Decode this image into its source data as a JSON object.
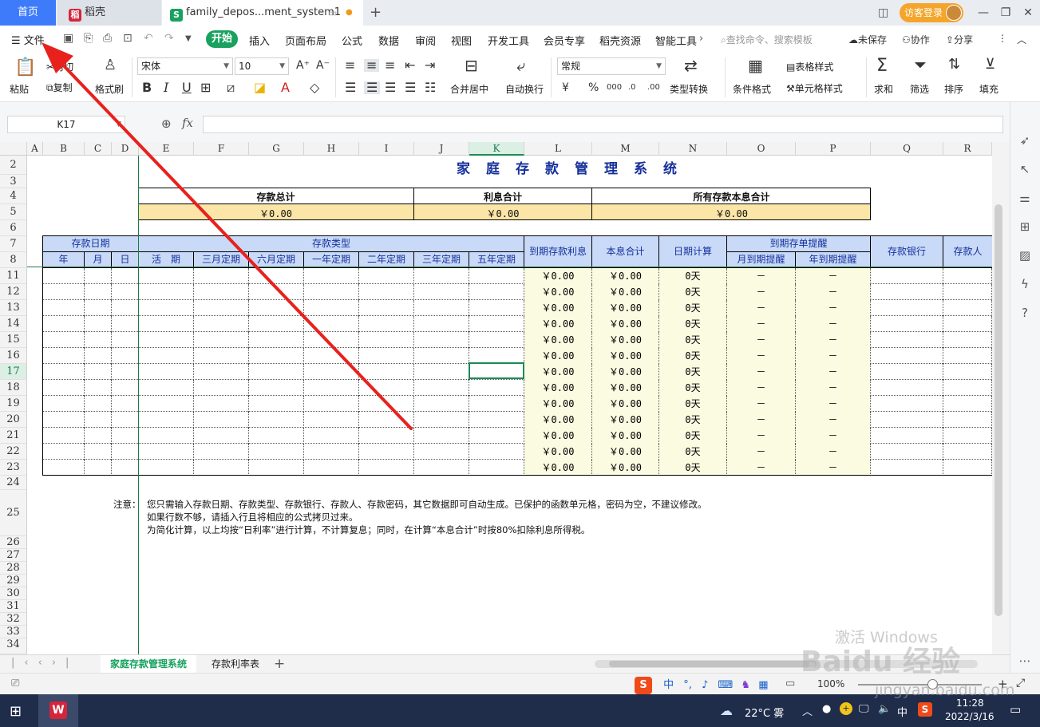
{
  "titlebar": {
    "home_tab": "首页",
    "tabs": [
      {
        "label": "稻壳"
      },
      {
        "label": "family_depos...ment_system1"
      }
    ],
    "add_tab": "+",
    "login_button": "访客登录"
  },
  "menu": {
    "file": "文件",
    "items": [
      "开始",
      "插入",
      "页面布局",
      "公式",
      "数据",
      "审阅",
      "视图",
      "开发工具",
      "会员专享",
      "稻壳资源",
      "智能工具"
    ],
    "search_placeholder": "查找命令、搜索模板",
    "unsaved": "未保存",
    "collaborate": "协作",
    "share": "分享"
  },
  "toolbar": {
    "paste": "粘贴",
    "cut": "剪切",
    "copy": "复制",
    "format_painter": "格式刷",
    "font_name": "宋体",
    "font_size": "10",
    "merge_center": "合并居中",
    "wrap_text": "自动换行",
    "number_format": "常规",
    "type_convert": "类型转换",
    "conditional_format": "条件格式",
    "table_style": "表格样式",
    "cell_style": "单元格样式",
    "sum": "求和",
    "filter": "筛选",
    "sort": "排序",
    "fill": "填充"
  },
  "formula_bar": {
    "name_box": "K17",
    "fx": "fx"
  },
  "grid": {
    "columns": [
      "A",
      "B",
      "C",
      "D",
      "E",
      "F",
      "G",
      "H",
      "I",
      "J",
      "K",
      "L",
      "M",
      "N",
      "O",
      "P",
      "Q",
      "R"
    ],
    "selected_column": "K",
    "rows": [
      "2",
      "3",
      "4",
      "5",
      "6",
      "7",
      "8",
      "11",
      "12",
      "13",
      "14",
      "15",
      "16",
      "17",
      "18",
      "19",
      "20",
      "21",
      "22",
      "23",
      "24",
      "25",
      "26",
      "27",
      "28",
      "29",
      "30",
      "31",
      "32",
      "33",
      "34"
    ],
    "selected_row": "17"
  },
  "sheet": {
    "title": "家庭存款管理系统",
    "totals_headers": [
      "存款总计",
      "利息合计",
      "所有存款本息合计"
    ],
    "totals_values": [
      "￥0.00",
      "￥0.00",
      "￥0.00"
    ],
    "group_headers": {
      "deposit_date": "存款日期",
      "deposit_type": "存款类型",
      "maturity_interest": "到期存款利息",
      "principal_interest": "本息合计",
      "day_count": "日期计算",
      "maturity_reminder": "到期存单提醒",
      "bank": "存款银行",
      "depositor": "存款人"
    },
    "sub_headers": {
      "date": [
        "年",
        "月",
        "日"
      ],
      "types": [
        "活　期",
        "三月定期",
        "六月定期",
        "一年定期",
        "二年定期",
        "三年定期",
        "五年定期"
      ],
      "reminders": [
        "月到期提醒",
        "年到期提醒"
      ]
    },
    "data_rows": [
      {
        "interest": "￥0.00",
        "total": "￥0.00",
        "days": "0天",
        "month_remind": "－",
        "year_remind": "－"
      },
      {
        "interest": "￥0.00",
        "total": "￥0.00",
        "days": "0天",
        "month_remind": "－",
        "year_remind": "－"
      },
      {
        "interest": "￥0.00",
        "total": "￥0.00",
        "days": "0天",
        "month_remind": "－",
        "year_remind": "－"
      },
      {
        "interest": "￥0.00",
        "total": "￥0.00",
        "days": "0天",
        "month_remind": "－",
        "year_remind": "－"
      },
      {
        "interest": "￥0.00",
        "total": "￥0.00",
        "days": "0天",
        "month_remind": "－",
        "year_remind": "－"
      },
      {
        "interest": "￥0.00",
        "total": "￥0.00",
        "days": "0天",
        "month_remind": "－",
        "year_remind": "－"
      },
      {
        "interest": "￥0.00",
        "total": "￥0.00",
        "days": "0天",
        "month_remind": "－",
        "year_remind": "－"
      },
      {
        "interest": "￥0.00",
        "total": "￥0.00",
        "days": "0天",
        "month_remind": "－",
        "year_remind": "－"
      },
      {
        "interest": "￥0.00",
        "total": "￥0.00",
        "days": "0天",
        "month_remind": "－",
        "year_remind": "－"
      },
      {
        "interest": "￥0.00",
        "total": "￥0.00",
        "days": "0天",
        "month_remind": "－",
        "year_remind": "－"
      },
      {
        "interest": "￥0.00",
        "total": "￥0.00",
        "days": "0天",
        "month_remind": "－",
        "year_remind": "－"
      },
      {
        "interest": "￥0.00",
        "total": "￥0.00",
        "days": "0天",
        "month_remind": "－",
        "year_remind": "－"
      },
      {
        "interest": "￥0.00",
        "total": "￥0.00",
        "days": "0天",
        "month_remind": "－",
        "year_remind": "－"
      }
    ],
    "notes": {
      "label": "注意：",
      "line1": "您只需输入存款日期、存款类型、存款银行、存款人、存款密码，其它数据即可自动生成。已保护的函数单元格，密码为空，不建议修改。",
      "line2": "如果行数不够，请插入行且将相应的公式拷贝过来。",
      "line3": "为简化计算，以上均按“日利率”进行计算，不计算复息；同时，在计算“本息合计”时按80%扣除利息所得税。"
    }
  },
  "sheet_tabs": [
    "家庭存款管理系统",
    "存款利率表"
  ],
  "status": {
    "zoom": "100%",
    "ime": "中"
  },
  "taskbar": {
    "weather": "22°C 雾",
    "ime": "中",
    "time": "11:28",
    "date": "2022/3/16"
  },
  "watermarks": {
    "activate_windows": "激活 Windows",
    "baidu": "Baidu 经验",
    "baidu_url": "jingyan.baidu.com"
  },
  "colors": {
    "accent_green": "#19a15f",
    "home_blue": "#3e7bfa",
    "header_blue": "#c9daf8",
    "total_yellow": "#fbe5a7",
    "arrow_red": "#e8211d"
  }
}
